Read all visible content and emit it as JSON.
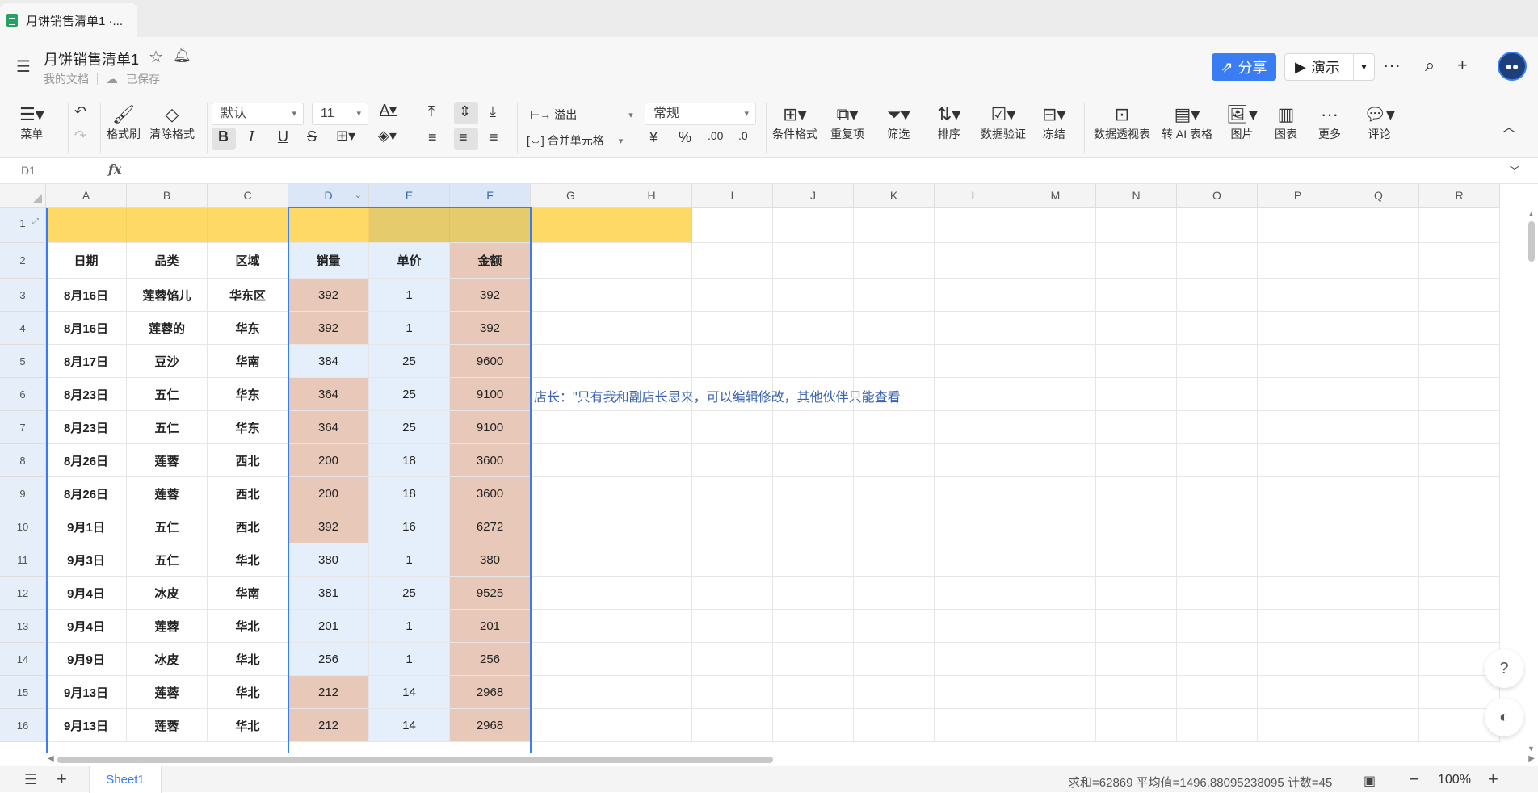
{
  "browser": {
    "tab_title": "月饼销售清单1 ·..."
  },
  "header": {
    "doc_title": "月饼销售清单1",
    "location": "我的文档",
    "save_status": "已保存",
    "share_label": "分享",
    "present_label": "演示",
    "more_label": "···"
  },
  "toolbar": {
    "menu_label": "菜单",
    "format_painter": "格式刷",
    "clear_format": "清除格式",
    "font_name": "默认",
    "font_size": "11",
    "overflow_label": "溢出",
    "merge_label": "合并单元格",
    "number_format": "常规",
    "conditional_format": "条件格式",
    "duplicates": "重复项",
    "filter": "筛选",
    "sort": "排序",
    "data_validation": "数据验证",
    "freeze": "冻结",
    "pivot": "数据透视表",
    "ai_table": "转 AI 表格",
    "picture": "图片",
    "chart": "图表",
    "more": "更多",
    "comment": "评论"
  },
  "formula_bar": {
    "cell_ref": "D1",
    "fx": "fx"
  },
  "grid": {
    "columns": [
      "A",
      "B",
      "C",
      "D",
      "E",
      "F",
      "G",
      "H",
      "I",
      "J",
      "K",
      "L",
      "M",
      "N",
      "O",
      "P",
      "Q",
      "R"
    ],
    "row_numbers": [
      "1",
      "2",
      "3",
      "4",
      "5",
      "6",
      "7",
      "8",
      "9",
      "10",
      "11",
      "12",
      "13",
      "14",
      "15",
      "16"
    ],
    "headers": [
      "日期",
      "品类",
      "区域",
      "销量",
      "单价",
      "金额"
    ],
    "rows": [
      [
        "8月16日",
        "莲蓉馅儿",
        "华东区",
        "392",
        "1",
        "392"
      ],
      [
        "8月16日",
        "莲蓉的",
        "华东",
        "392",
        "1",
        "392"
      ],
      [
        "8月17日",
        "豆沙",
        "华南",
        "384",
        "25",
        "9600"
      ],
      [
        "8月23日",
        "五仁",
        "华东",
        "364",
        "25",
        "9100"
      ],
      [
        "8月23日",
        "五仁",
        "华东",
        "364",
        "25",
        "9100"
      ],
      [
        "8月26日",
        "莲蓉",
        "西北",
        "200",
        "18",
        "3600"
      ],
      [
        "8月26日",
        "莲蓉",
        "西北",
        "200",
        "18",
        "3600"
      ],
      [
        "9月1日",
        "五仁",
        "西北",
        "392",
        "16",
        "6272"
      ],
      [
        "9月3日",
        "五仁",
        "华北",
        "380",
        "1",
        "380"
      ],
      [
        "9月4日",
        "冰皮",
        "华南",
        "381",
        "25",
        "9525"
      ],
      [
        "9月4日",
        "莲蓉",
        "华北",
        "201",
        "1",
        "201"
      ],
      [
        "9月9日",
        "冰皮",
        "华北",
        "256",
        "1",
        "256"
      ],
      [
        "9月13日",
        "莲蓉",
        "华北",
        "212",
        "14",
        "2968"
      ],
      [
        "9月13日",
        "莲蓉",
        "华北",
        "212",
        "14",
        "2968"
      ]
    ],
    "highlight_d": [
      true,
      true,
      false,
      true,
      true,
      true,
      true,
      true,
      false,
      false,
      false,
      false,
      true,
      true
    ],
    "note": "店长：\"只有我和副店长思来，可以编辑修改，其他伙伴只能查看"
  },
  "colors": {
    "accent": "#3a7df2",
    "header_fill": "#ffd966",
    "header_fill_selected": "#e5cb6b",
    "highlight_fill": "#e8c8b8",
    "selected_fill": "#e5eefb"
  },
  "footer": {
    "sheet_name": "Sheet1",
    "stats": "求和=62869  平均值=1496.88095238095  计数=45",
    "zoom": "100%"
  }
}
